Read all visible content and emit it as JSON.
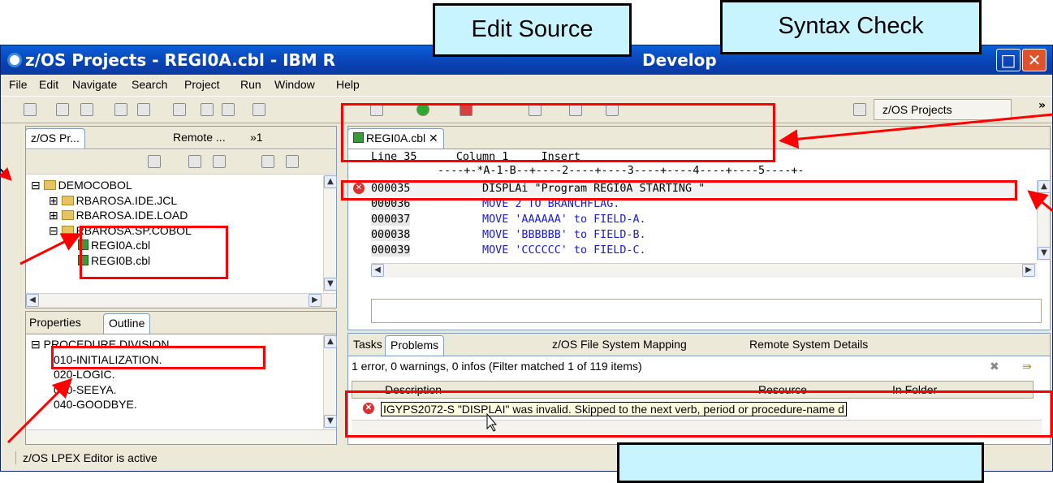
{
  "window": {
    "title": "z/OS Projects - REGI0A.cbl - IBM R",
    "title_right": "Develop"
  },
  "menu": [
    "File",
    "Edit",
    "Navigate",
    "Search",
    "Project",
    "Run",
    "Window",
    "Help"
  ],
  "perspective": {
    "label": "z/OS Projects"
  },
  "left_top": {
    "tabs": [
      "z/OS Pr...",
      "Remote ...",
      "»1"
    ],
    "tree": [
      {
        "label": "DEMOCOBOL"
      },
      {
        "label": "RBAROSA.IDE.JCL"
      },
      {
        "label": "RBAROSA.IDE.LOAD"
      },
      {
        "label": "RBAROSA.SP.COBOL"
      },
      {
        "label": "REGI0A.cbl"
      },
      {
        "label": "REGI0B.cbl"
      }
    ]
  },
  "left_bottom": {
    "tabs": [
      "Properties",
      "Outline"
    ],
    "tree": [
      "PROCEDURE DIVISION.",
      "010-INITIALIZATION.",
      "020-LOGIC.",
      "030-SEEYA.",
      "040-GOODBYE."
    ]
  },
  "editor": {
    "tab": "REGI0A.cbl",
    "status": {
      "line": "Line 35",
      "column": "Column 1",
      "mode": "Insert"
    },
    "ruler": "----+-*A-1-B--+----2----+----3----+----4----+----5----+-",
    "lines": [
      {
        "num": "000035",
        "text": "           DISPLAi \"Program REGI0A STARTING \""
      },
      {
        "num": "000036",
        "text": "           MOVE 2 TO BRANCHFLAG."
      },
      {
        "num": "000037",
        "text": "           MOVE 'AAAAAA' to FIELD-A."
      },
      {
        "num": "000038",
        "text": "           MOVE 'BBBBBB' to FIELD-B."
      },
      {
        "num": "000039",
        "text": "           MOVE 'CCCCCC' to FIELD-C."
      }
    ]
  },
  "bottom": {
    "tabs": [
      "Tasks",
      "Problems",
      "z/OS File System Mapping",
      "Remote System Details"
    ],
    "summary": "1 error, 0 warnings, 0 infos (Filter matched 1 of 119 items)",
    "columns": [
      "Description",
      "Resource",
      "In Folder"
    ],
    "error": "IGYPS2072-S \"DISPLAI\" was invalid.  Skipped to the next verb, period or procedure-name d"
  },
  "status": {
    "text": "z/OS LPEX Editor is active"
  },
  "callouts": {
    "edit": "Edit Source",
    "syntax": "Syntax Check"
  }
}
